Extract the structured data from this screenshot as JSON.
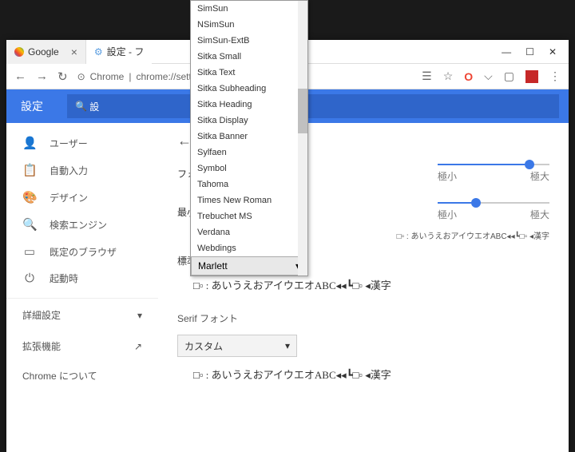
{
  "tabs": {
    "inactive": "Google",
    "active": "設定 - フ"
  },
  "winbtns": {
    "min": "—",
    "max": "☐",
    "close": "✕"
  },
  "url": {
    "prefix": "Chrome",
    "sep": " | ",
    "path": "chrome://settings/fo"
  },
  "header": {
    "title": "設定",
    "search": "設"
  },
  "sidebar": {
    "items": [
      {
        "icon": "👤",
        "label": "ユーザー"
      },
      {
        "icon": "📋",
        "label": "自動入力"
      },
      {
        "icon": "🎨",
        "label": "デザイン"
      },
      {
        "icon": "🔍",
        "label": "検索エンジン"
      },
      {
        "icon": "▭",
        "label": "既定のブラウザ"
      },
      {
        "icon": "⏻",
        "label": "起動時"
      }
    ],
    "advanced": "詳細設定",
    "ext": "拡張機能",
    "about": "Chrome について"
  },
  "main": {
    "fontsize": "フォン",
    "minfont": "最小フ",
    "standard": "標準フ",
    "serif": "Serif フォント",
    "min_label": "極小",
    "max_label": "極大",
    "sample_small": "□▫ :  あいうえおアイウエオABC◂◂┗□▫ ◂漢字",
    "sample": "□▫ :  あいうえおアイウエオABC◂◂┗□▫ ◂漢字",
    "sample2": "□▫ :  あいうえおアイウエオABC◂◂┗□▫ ◂漢字",
    "custom": "カスタム"
  },
  "dropdown": {
    "items": [
      "SimSun",
      "NSimSun",
      "SimSun-ExtB",
      "Sitka Small",
      "Sitka Text",
      "Sitka Subheading",
      "Sitka Heading",
      "Sitka Display",
      "Sitka Banner",
      "Sylfaen",
      "Symbol",
      "Tahoma",
      "Times New Roman",
      "Trebuchet MS",
      "Verdana",
      "Webdings"
    ],
    "selected": "Marlett"
  }
}
